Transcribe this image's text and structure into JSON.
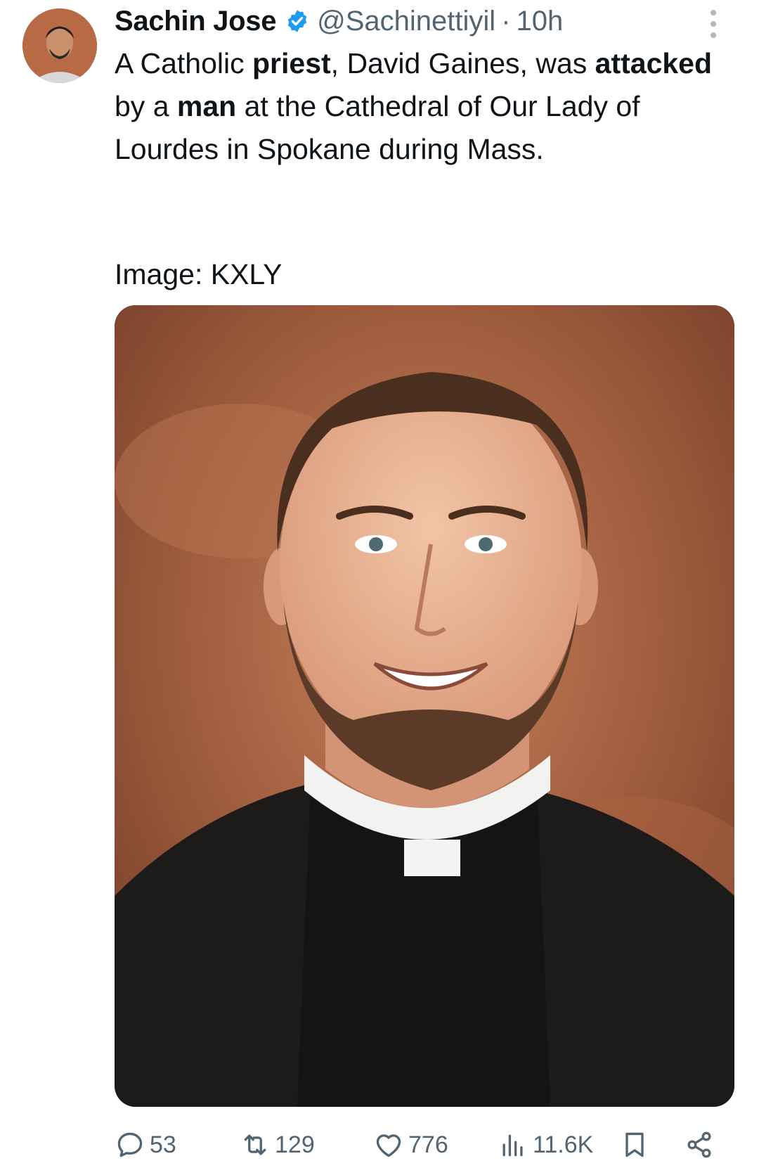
{
  "tweet": {
    "author_name": "Sachin Jose",
    "author_handle": "@Sachinettiyil",
    "separator": "·",
    "time": "10h",
    "text_parts": [
      {
        "t": "A Catholic ",
        "bold": false
      },
      {
        "t": "priest",
        "bold": true
      },
      {
        "t": ", David Gaines, was ",
        "bold": false
      },
      {
        "t": "attacked",
        "bold": true
      },
      {
        "t": " by a ",
        "bold": false
      },
      {
        "t": "man",
        "bold": true
      },
      {
        "t": " at the Cathedral of Our Lady of Lourdes in Spokane during Mass.",
        "bold": false
      }
    ],
    "image_credit": "Image: KXLY"
  },
  "metrics": {
    "replies": "53",
    "retweets": "129",
    "likes": "776",
    "views": "11.6K"
  },
  "icons": {
    "verified": "verified-badge-icon",
    "more": "more-vertical-icon",
    "reply": "reply-icon",
    "retweet": "retweet-icon",
    "like": "heart-icon",
    "views": "views-chart-icon",
    "bookmark": "bookmark-icon",
    "share": "share-icon"
  },
  "colors": {
    "text": "#0f1419",
    "secondary": "#536471",
    "verified": "#1d9bf0",
    "background": "#ffffff"
  }
}
